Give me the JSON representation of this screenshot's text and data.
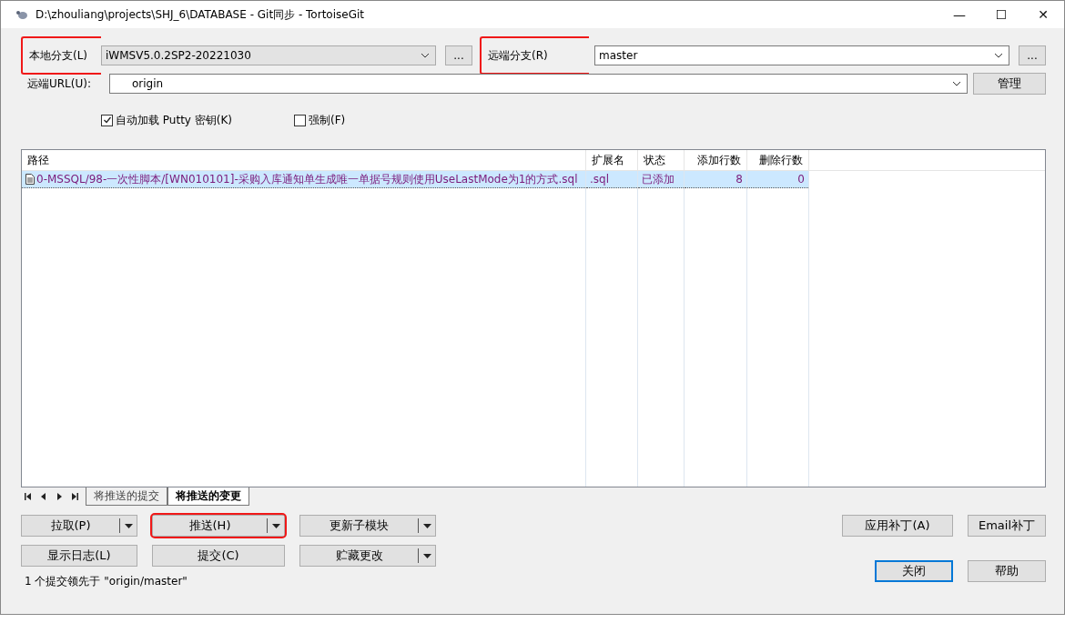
{
  "window": {
    "title": "D:\\zhouliang\\projects\\SHJ_6\\DATABASE - Git同步 - TortoiseGit",
    "controls": [
      "—",
      "☐",
      "✕"
    ]
  },
  "local_branch": {
    "label": "本地分支(L)",
    "value": "iWMSV5.0.2SP2-20221030",
    "browse": "...",
    "highlighted": true
  },
  "remote_branch": {
    "label": "远端分支(R)",
    "value": "master",
    "browse": "...",
    "highlighted": true
  },
  "remote_url": {
    "label": "远端URL(U):",
    "value": "origin",
    "manage": "管理"
  },
  "options": [
    {
      "label": "自动加载 Putty 密钥(K)",
      "checked": true
    },
    {
      "label": "强制(F)",
      "checked": false
    }
  ],
  "table": {
    "columns": [
      "路径",
      "扩展名",
      "状态",
      "添加行数",
      "删除行数"
    ],
    "rows": [
      {
        "cells": [
          "0-MSSQL/98-一次性脚本/[WN010101]-采购入库通知单生成唯一单据号规则使用UseLastMode为1的方式.sql",
          ".sql",
          "已添加",
          "8",
          "0"
        ],
        "selected": true
      }
    ]
  },
  "tabs": [
    {
      "label": "将推送的提交",
      "selected": false
    },
    {
      "label": "将推送的变更",
      "selected": true
    }
  ],
  "buttons": [
    {
      "label": "拉取(P)",
      "split": true,
      "highlighted": false
    },
    {
      "label": "推送(H)",
      "split": true,
      "highlighted": true
    },
    {
      "label": "更新子模块",
      "split": true,
      "highlighted": false
    },
    {
      "label": "显示日志(L)",
      "split": false,
      "highlighted": false
    },
    {
      "label": "提交(C)",
      "split": false,
      "highlighted": false
    },
    {
      "label": "贮藏更改",
      "split": true,
      "highlighted": false
    }
  ],
  "right_buttons": [
    {
      "label": "应用补丁(A)",
      "default": false
    },
    {
      "label": "Email补丁",
      "default": false
    },
    {
      "label": "关闭",
      "default": true
    },
    {
      "label": "帮助",
      "default": false
    }
  ],
  "status_bar": "1 个提交领先于 \"origin/master\""
}
